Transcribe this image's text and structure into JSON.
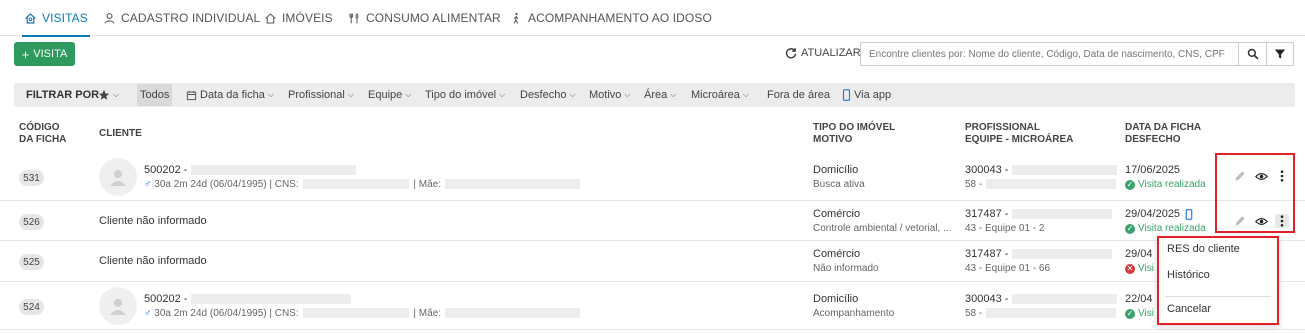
{
  "tabs": [
    {
      "label": "VISITAS",
      "icon": "home-icon",
      "active": true
    },
    {
      "label": "CADASTRO INDIVIDUAL",
      "icon": "user-icon"
    },
    {
      "label": "IMÓVEIS",
      "icon": "house-icon"
    },
    {
      "label": "CONSUMO ALIMENTAR",
      "icon": "utensils-icon"
    },
    {
      "label": "ACOMPANHAMENTO AO IDOSO",
      "icon": "walking-icon"
    }
  ],
  "toolbar": {
    "visita_label": "VISITA",
    "atualizar_label": "ATUALIZAR",
    "search_placeholder": "Encontre clientes por: Nome do cliente, Código, Data de nascimento, CNS, CPF"
  },
  "filters": {
    "label": "FILTRAR POR",
    "todos": "Todos",
    "items": [
      "Data da ficha",
      "Profissional",
      "Equipe",
      "Tipo do imóvel",
      "Desfecho",
      "Motivo",
      "Área",
      "Microárea",
      "Fora de área",
      "Via app"
    ]
  },
  "table": {
    "headers": {
      "codigo": [
        "CÓDIGO",
        "DA FICHA"
      ],
      "cliente": "CLIENTE",
      "tipo": [
        "TIPO DO IMÓVEL",
        "MOTIVO"
      ],
      "profissional": [
        "PROFISSIONAL",
        "EQUIPE - MICROÁREA"
      ],
      "data": [
        "DATA DA FICHA",
        "DESFECHO"
      ]
    },
    "rows": [
      {
        "code": "531",
        "client_id": "500202 -",
        "client_info": "30a 2m 24d (06/04/1995) | CNS:",
        "mae": "| Mãe:",
        "tipo": "Domicílio",
        "motivo": "Busca ativa",
        "prof": "300043 -",
        "equipe": "58 -",
        "data": "17/06/2025",
        "desfecho": "Visita realizada"
      },
      {
        "code": "526",
        "client_name": "Cliente não informado",
        "tipo": "Comércio",
        "motivo": "Controle ambiental / vetorial, ...",
        "prof": "317487 -",
        "equipe": "43 - Equipe 01 - 2",
        "data": "29/04/2025",
        "desfecho": "Visita realizada"
      },
      {
        "code": "525",
        "client_name": "Cliente não informado",
        "tipo": "Comércio",
        "motivo": "Não informado",
        "prof": "317487 -",
        "equipe": "43 - Equipe 01 - 66",
        "data": "29/04",
        "desfecho": "Visi"
      },
      {
        "code": "524",
        "client_id": "500202 -",
        "client_info": "30a 2m 24d (06/04/1995) | CNS:",
        "mae": "| Mãe:",
        "tipo": "Domicílio",
        "motivo": "Acompanhamento",
        "prof": "300043 -",
        "equipe": "58 -",
        "data": "22/04",
        "desfecho": "Visi"
      }
    ]
  },
  "context_menu": {
    "items": [
      "RES do cliente",
      "Histórico",
      "Cancelar"
    ]
  },
  "colors": {
    "accent": "#0e7ab8",
    "primary_button": "#2e9a5e",
    "success": "#3aa36b",
    "highlight": "#e2202a"
  }
}
